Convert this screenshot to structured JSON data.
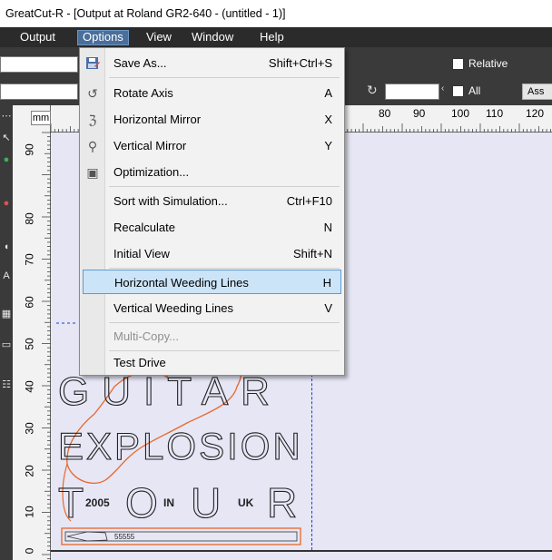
{
  "window": {
    "title": "GreatCut-R - [Output at Roland GR2-640 - (untitled - 1)]"
  },
  "menubar": {
    "items": [
      {
        "label": "Output"
      },
      {
        "label": "Options"
      },
      {
        "label": "View"
      },
      {
        "label": "Window"
      },
      {
        "label": "Help"
      }
    ]
  },
  "toolbar": {
    "relative_label": "Relative",
    "all_label": "All",
    "button_label": "Ass"
  },
  "ruler": {
    "unit": "mm",
    "h_ticks": [
      "80",
      "90",
      "100",
      "110",
      "120"
    ],
    "v_ticks": [
      "90",
      "80",
      "70",
      "60",
      "50",
      "40",
      "30",
      "20",
      "10",
      "0"
    ]
  },
  "options_menu": {
    "items": [
      {
        "label": "Save As...",
        "shortcut": "Shift+Ctrl+S",
        "icon": "save-as-icon",
        "enabled": true
      },
      {
        "label": "Rotate Axis",
        "shortcut": "A",
        "icon": "rotate-axis-icon",
        "enabled": true
      },
      {
        "label": "Horizontal Mirror",
        "shortcut": "X",
        "icon": "horizontal-mirror-icon",
        "enabled": true
      },
      {
        "label": "Vertical Mirror",
        "shortcut": "Y",
        "icon": "vertical-mirror-icon",
        "enabled": true
      },
      {
        "label": "Optimization...",
        "shortcut": "",
        "icon": "optimization-icon",
        "enabled": true
      },
      {
        "label": "Sort with Simulation...",
        "shortcut": "Ctrl+F10",
        "icon": "",
        "enabled": true
      },
      {
        "label": "Recalculate",
        "shortcut": "N",
        "icon": "",
        "enabled": true
      },
      {
        "label": "Initial View",
        "shortcut": "Shift+N",
        "icon": "",
        "enabled": true
      },
      {
        "label": "Horizontal Weeding Lines",
        "shortcut": "H",
        "icon": "",
        "enabled": true,
        "highlighted": true
      },
      {
        "label": "Vertical Weeding Lines",
        "shortcut": "V",
        "icon": "",
        "enabled": true
      },
      {
        "label": "Multi-Copy...",
        "shortcut": "",
        "icon": "",
        "enabled": false
      },
      {
        "label": "Test Drive",
        "shortcut": "",
        "icon": "",
        "enabled": true
      }
    ]
  },
  "artwork": {
    "line1": "GUITAR",
    "line2": "EXPLOSION",
    "line3_left": "T",
    "line3_year": "2005",
    "line3_o": "O",
    "line3_in": "IN",
    "line3_u": "U",
    "line3_uk": "UK",
    "line3_right": "R",
    "guitar_text": "55555"
  },
  "colors": {
    "menubar_bg": "#2b2b2b",
    "canvas_bg": "#e6e6f5",
    "highlight_bg": "#cce4f7",
    "highlight_border": "#5b9bd5",
    "guitar_outline": "#e8672a",
    "page_border": "#1f3cd1"
  }
}
